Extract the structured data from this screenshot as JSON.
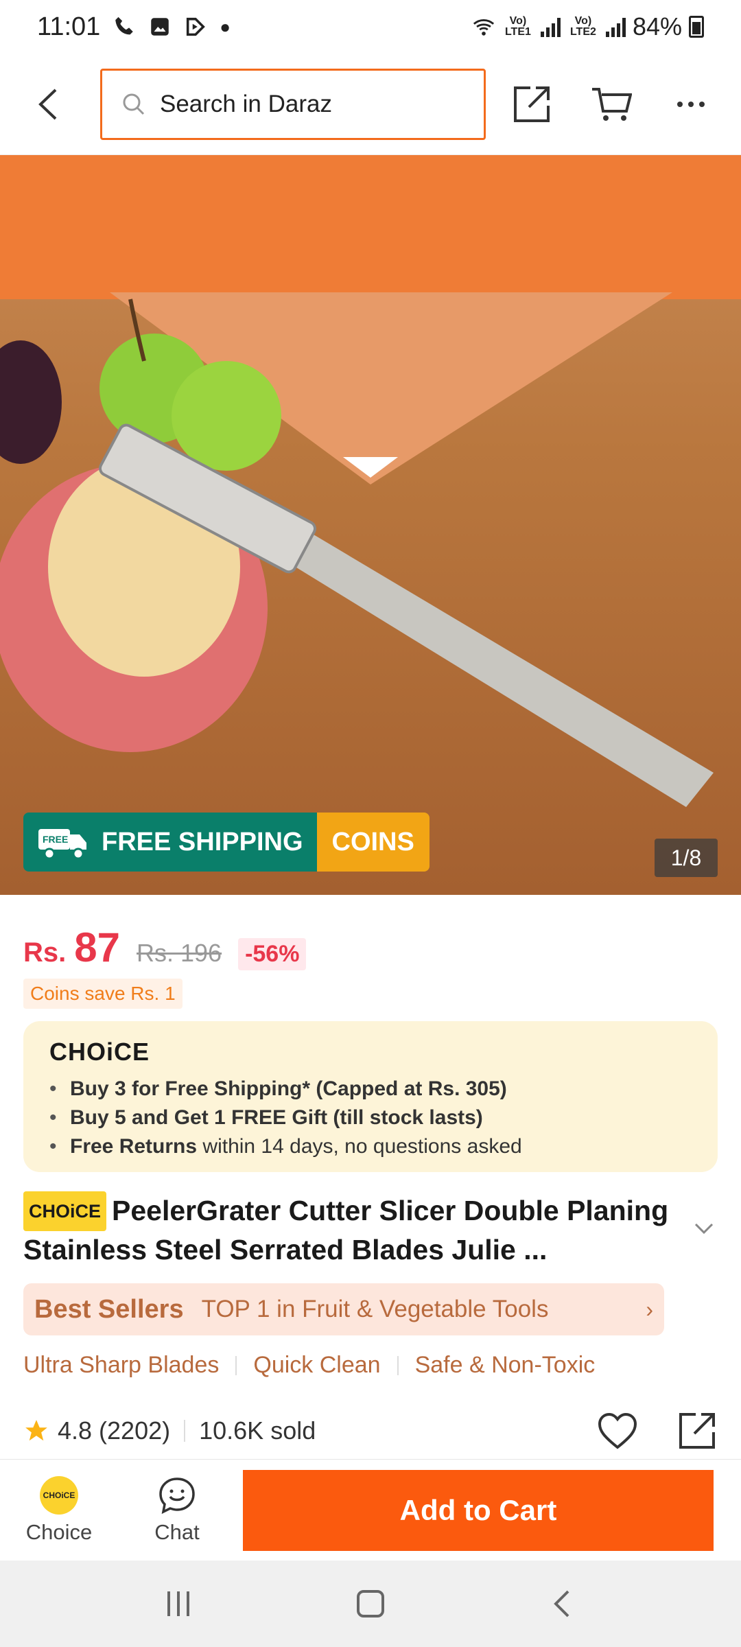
{
  "status_bar": {
    "time": "11:01",
    "battery": "84%",
    "sim1": "Vo) LTE1",
    "sim2": "Vo) LTE2"
  },
  "header": {
    "search_placeholder": "Search in Daraz"
  },
  "hero": {
    "free_shipping": "FREE SHIPPING",
    "free_tag": "FREE",
    "coins": "COINS",
    "counter": "1/8"
  },
  "price": {
    "currency": "Rs.",
    "value": "87",
    "original": "Rs. 196",
    "discount": "-56%",
    "coins_save": "Coins save Rs. 1"
  },
  "choice": {
    "logo": "CHOiCE",
    "items": [
      {
        "bold": "Buy 3 for  Free Shipping* (Capped at Rs. 305)",
        "rest": ""
      },
      {
        "bold": "Buy 5 and Get 1 FREE Gift (till stock lasts)",
        "rest": ""
      },
      {
        "bold": "Free Returns",
        "rest": " within 14 days, no questions asked"
      }
    ]
  },
  "product": {
    "tag": "CHOiCE",
    "title": "PeelerGrater Cutter Slicer Double Planing Stainless Steel Serrated Blades Julie ..."
  },
  "best_sellers": {
    "title": "Best Sellers",
    "text": "TOP 1 in Fruit & Vegetable Tools"
  },
  "features": [
    "Ultra Sharp Blades",
    "Quick Clean",
    "Safe & Non-Toxic"
  ],
  "rating": {
    "score": "4.8",
    "count": "(2202)",
    "sold": "10.6K sold"
  },
  "action_bar": {
    "choice_label": "Choice",
    "choice_icon_text": "CHOiCE",
    "chat_label": "Chat",
    "add_to_cart": "Add to Cart"
  },
  "colors": {
    "accent": "#fb5a0e",
    "price": "#e8374a",
    "choice_bg": "#fdf4d8",
    "best_sellers_bg": "#fde6dc",
    "shipping_green": "#0a7f6a",
    "coins_yellow": "#f2a515"
  },
  "icons": [
    "back-arrow-icon",
    "search-icon",
    "share-icon",
    "cart-icon",
    "more-icon",
    "star-icon",
    "heart-icon",
    "chat-icon",
    "truck-icon",
    "chevron-down-icon",
    "chevron-right-icon"
  ]
}
